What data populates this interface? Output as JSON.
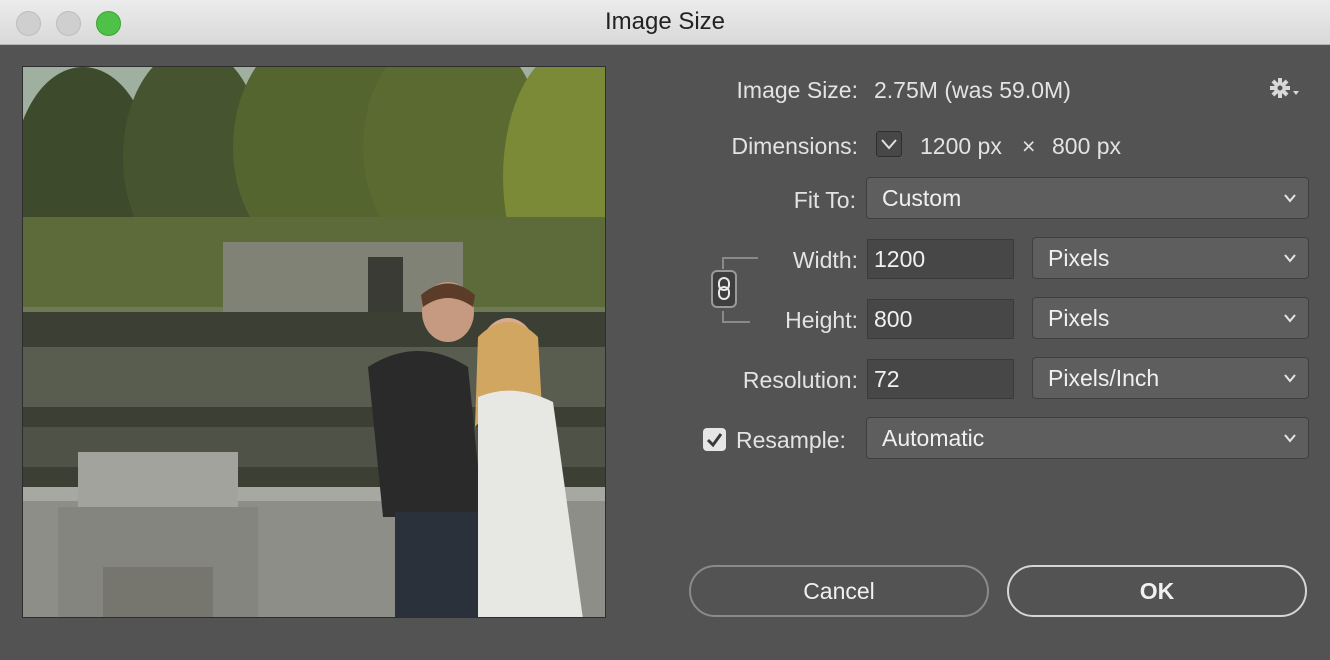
{
  "window": {
    "title": "Image Size"
  },
  "image_size": {
    "label": "Image Size:",
    "value": "2.75M (was 59.0M)"
  },
  "dimensions": {
    "label": "Dimensions:",
    "width": "1200 px",
    "times": "×",
    "height": "800 px"
  },
  "fit_to": {
    "label": "Fit To:",
    "value": "Custom"
  },
  "width": {
    "label": "Width:",
    "value": "1200",
    "unit": "Pixels"
  },
  "height": {
    "label": "Height:",
    "value": "800",
    "unit": "Pixels"
  },
  "resolution": {
    "label": "Resolution:",
    "value": "72",
    "unit": "Pixels/Inch"
  },
  "resample": {
    "label": "Resample:",
    "value": "Automatic",
    "checked": true
  },
  "buttons": {
    "cancel": "Cancel",
    "ok": "OK"
  },
  "icons": {
    "gear": "gear-icon",
    "link": "chain-link-icon",
    "dimensions_toggle": "chevron-down-icon",
    "select_arrow": "chevron-down-icon",
    "resample_check": "checkmark-icon"
  },
  "colors": {
    "background": "#535353",
    "zoom_button": "#4fc048"
  }
}
